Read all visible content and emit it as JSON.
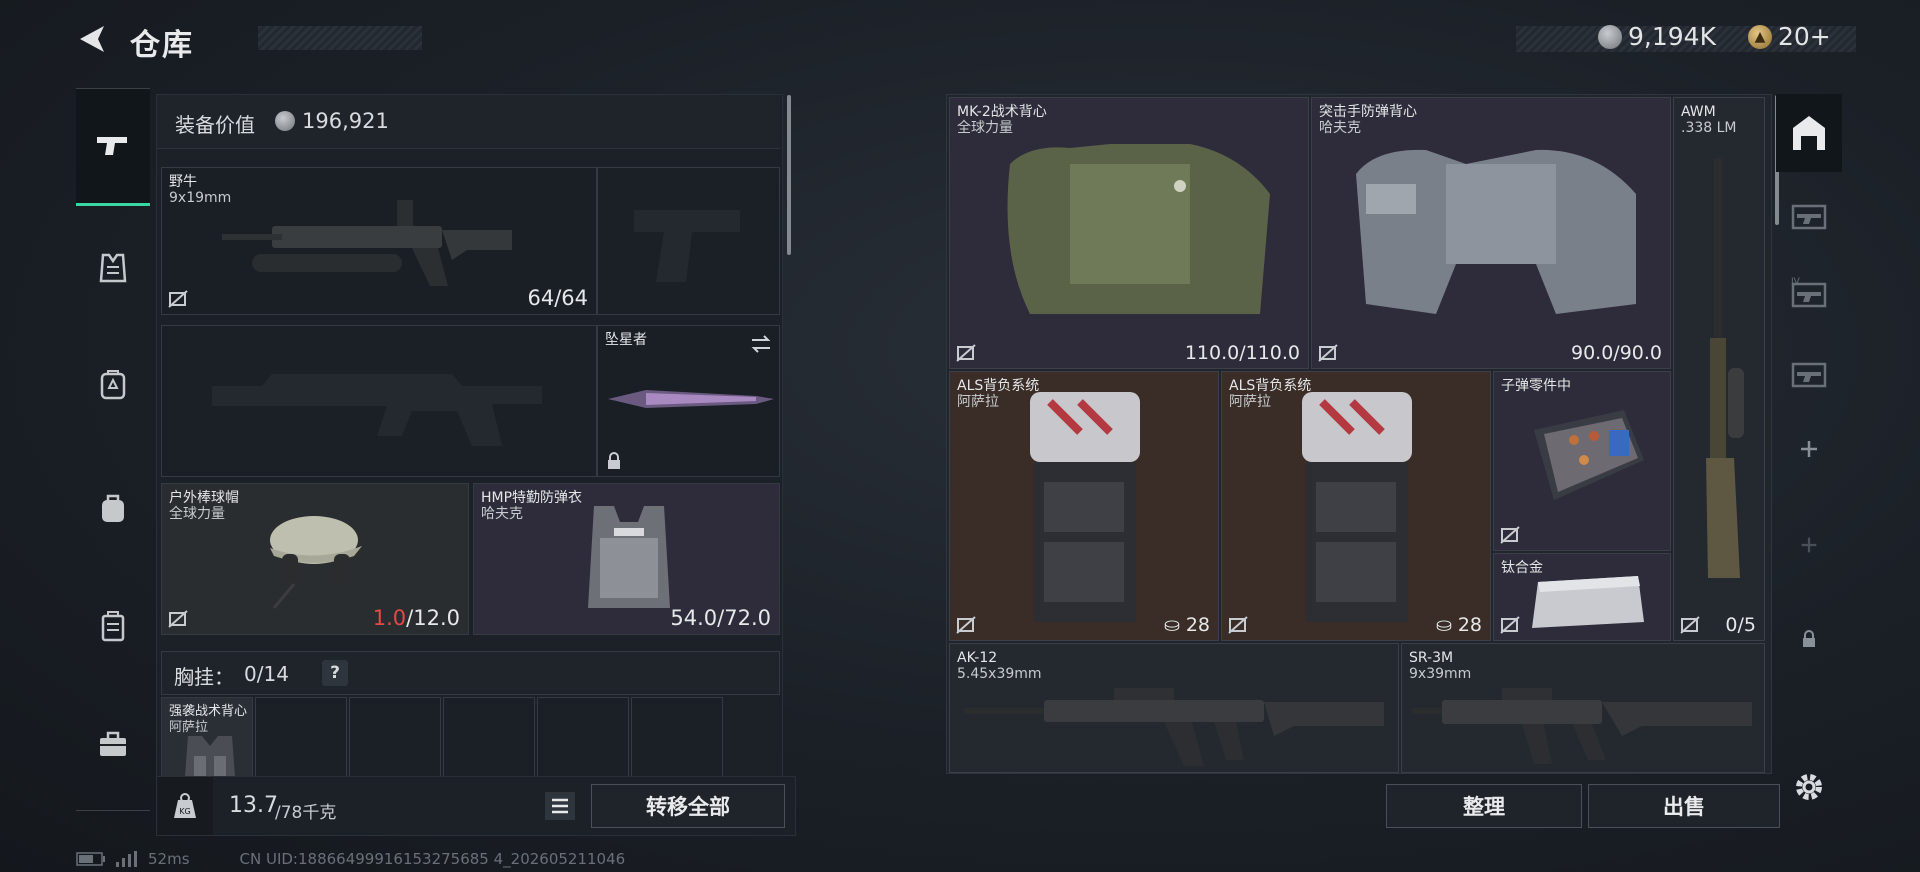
{
  "header": {
    "title": "仓库",
    "silver": "9,194K",
    "gold": "20+"
  },
  "left": {
    "equip_label": "装备价值",
    "equip_value": "196,921",
    "primary": {
      "name": "野牛",
      "caliber": "9x19mm",
      "ammo": "64/64"
    },
    "melee": {
      "name": "坠星者"
    },
    "helmet": {
      "name": "户外棒球帽",
      "brand": "全球力量",
      "dur_current": "1.0",
      "dur_max": "/12.0"
    },
    "armor": {
      "name": "HMP特勤防弹衣",
      "brand": "哈夫克",
      "durability": "54.0/72.0"
    },
    "chest": {
      "label": "胸挂",
      "count": "0/14",
      "help": "?"
    },
    "chest_item": {
      "name": "强袭战术背心",
      "brand": "阿萨拉"
    },
    "weight": {
      "current": "13.7",
      "max": "/78千克"
    },
    "transfer_all": "转移全部"
  },
  "storage": {
    "items": [
      {
        "name": "MK-2战术背心",
        "brand": "全球力量",
        "value": "110.0/110.0"
      },
      {
        "name": "突击手防弹背心",
        "brand": "哈夫克",
        "value": "90.0/90.0"
      },
      {
        "name": "AWM",
        "brand": ".338 LM",
        "value": "0/5"
      },
      {
        "name": "ALS背负系统",
        "brand": "阿萨拉",
        "value": "28"
      },
      {
        "name": "ALS背负系统",
        "brand": "阿萨拉",
        "value": "28"
      },
      {
        "name": "子弹零件中",
        "brand": "",
        "value": ""
      },
      {
        "name": "钛合金",
        "brand": "",
        "value": ""
      },
      {
        "name": "AK-12",
        "brand": "5.45x39mm",
        "value": ""
      },
      {
        "name": "SR-3M",
        "brand": "9x39mm",
        "value": ""
      }
    ],
    "organize": "整理",
    "sell": "出售"
  },
  "status": {
    "ping": "52ms",
    "uid": "CN UID:18866499916153275685 4_202605211046"
  },
  "colors": {
    "accent": "#3bd6a3",
    "low_durability": "#e24a46",
    "rarity_purple": "#2e2c3a",
    "rarity_brown": "#3a2d27"
  }
}
